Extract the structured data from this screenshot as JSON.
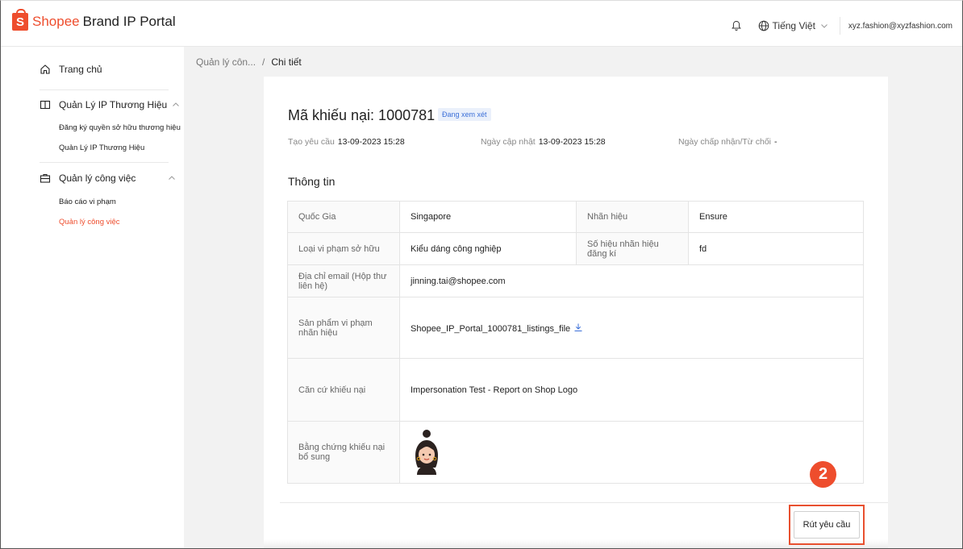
{
  "header": {
    "logo_letter": "S",
    "brand_shopee": "Shopee",
    "brand_rest": "Brand IP Portal",
    "language": "Tiếng Việt",
    "user_email": "xyz.fashion@xyzfashion.com"
  },
  "sidebar": {
    "home": "Trang chủ",
    "groups": [
      {
        "label": "Quản Lý IP Thương Hiệu",
        "items": [
          "Đăng ký quyền sở hữu thương hiệu",
          "Quản Lý IP Thương Hiệu"
        ]
      },
      {
        "label": "Quản lý công việc",
        "items": [
          "Báo cáo vi phạm",
          "Quản lý công việc"
        ]
      }
    ],
    "active_item": "Quản lý công việc"
  },
  "breadcrumb": {
    "parent": "Quản lý côn...",
    "separator": "/",
    "current": "Chi tiết"
  },
  "detail": {
    "title": "Mã khiếu nại: 1000781",
    "status": "Đang xem xét",
    "created_label": "Tạo yêu cầu",
    "created_value": "13-09-2023 15:28",
    "updated_label": "Ngày cập nhật",
    "updated_value": "13-09-2023 15:28",
    "decided_label": "Ngày chấp nhận/Từ chối",
    "decided_value": "-",
    "section_title": "Thông tin"
  },
  "info_table": {
    "country_label": "Quốc Gia",
    "country_value": "Singapore",
    "brand_label": "Nhãn hiệu",
    "brand_value": "Ensure",
    "violation_label": "Loại vi phạm sở hữu",
    "violation_value": "Kiểu dáng công nghiệp",
    "reg_label": "Số hiệu nhãn hiệu đăng kí",
    "reg_value": "fd",
    "email_label": "Địa chỉ email (Hộp thư liên hệ)",
    "email_value": "jinning.tai@shopee.com",
    "products_label": "Sản phẩm vi phạm nhãn hiệu",
    "products_value": "Shopee_IP_Portal_1000781_listings_file",
    "basis_label": "Căn cứ khiếu nại",
    "basis_value": "Impersonation Test - Report on Shop Logo",
    "evidence_label": "Bằng chứng khiếu nại bổ sung"
  },
  "actions": {
    "withdraw": "Rút yêu cầu"
  },
  "annotation": {
    "step": "2"
  },
  "colors": {
    "accent": "#ee4d2d",
    "badge_bg": "#eaf0fb",
    "badge_text": "#3b6fd8"
  },
  "icons": [
    "bell-icon",
    "globe-icon",
    "home-icon",
    "book-icon",
    "briefcase-icon",
    "download-icon",
    "chevron-down-icon",
    "chevron-up-icon"
  ]
}
